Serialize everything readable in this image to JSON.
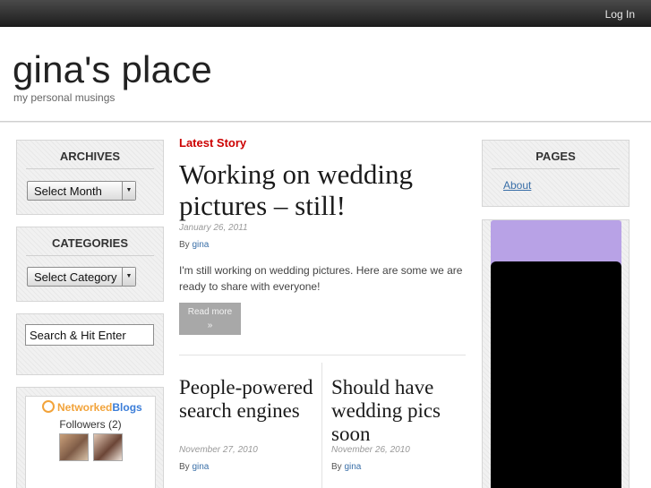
{
  "topbar": {
    "login_label": "Log In"
  },
  "site": {
    "title": "gina's place",
    "description": "my personal musings"
  },
  "archives": {
    "title": "ARCHIVES",
    "select_value": "Select Month"
  },
  "categories": {
    "title": "CATEGORIES",
    "select_value": "Select Category"
  },
  "search": {
    "value": "Search & Hit Enter"
  },
  "networked_blogs": {
    "logo_prefix": "Networked",
    "logo_suffix": "Blogs",
    "followers": "Followers (2)"
  },
  "latest": {
    "label": "Latest Story",
    "title": "Working on wedding pictures – still!",
    "date": "January 26, 2011",
    "by": "By",
    "author": "gina",
    "excerpt": "I'm still working on wedding pictures. Here are some we are ready to share with everyone!",
    "read_more": "Read more",
    "read_more_arrow": "»"
  },
  "posts": [
    {
      "title": "People-powered search engines",
      "date": "November 27, 2010",
      "by": "By",
      "author": "gina"
    },
    {
      "title": "Should have wedding pics soon",
      "date": "November 26, 2010",
      "by": "By",
      "author": "gina"
    }
  ],
  "pages": {
    "title": "PAGES",
    "items": [
      {
        "label": "About"
      }
    ]
  },
  "colors": {
    "accent_red": "#cc0000",
    "link_blue": "#3a6fa8",
    "purple_panel": "#b8a2e6"
  },
  "icons": {
    "select_arrow": "dropdown-arrow-icon",
    "networkedblogs_logo": "networkedblogs-logo-icon"
  }
}
